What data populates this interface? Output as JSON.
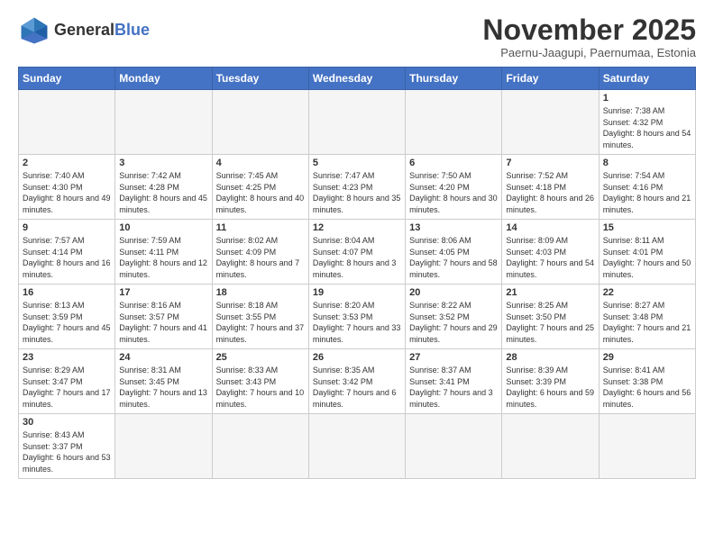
{
  "header": {
    "logo_general": "General",
    "logo_blue": "Blue",
    "month_title": "November 2025",
    "location": "Paernu-Jaagupi, Paernumaa, Estonia"
  },
  "weekdays": [
    "Sunday",
    "Monday",
    "Tuesday",
    "Wednesday",
    "Thursday",
    "Friday",
    "Saturday"
  ],
  "weeks": [
    [
      {
        "day": "",
        "info": ""
      },
      {
        "day": "",
        "info": ""
      },
      {
        "day": "",
        "info": ""
      },
      {
        "day": "",
        "info": ""
      },
      {
        "day": "",
        "info": ""
      },
      {
        "day": "",
        "info": ""
      },
      {
        "day": "1",
        "info": "Sunrise: 7:38 AM\nSunset: 4:32 PM\nDaylight: 8 hours and 54 minutes."
      }
    ],
    [
      {
        "day": "2",
        "info": "Sunrise: 7:40 AM\nSunset: 4:30 PM\nDaylight: 8 hours and 49 minutes."
      },
      {
        "day": "3",
        "info": "Sunrise: 7:42 AM\nSunset: 4:28 PM\nDaylight: 8 hours and 45 minutes."
      },
      {
        "day": "4",
        "info": "Sunrise: 7:45 AM\nSunset: 4:25 PM\nDaylight: 8 hours and 40 minutes."
      },
      {
        "day": "5",
        "info": "Sunrise: 7:47 AM\nSunset: 4:23 PM\nDaylight: 8 hours and 35 minutes."
      },
      {
        "day": "6",
        "info": "Sunrise: 7:50 AM\nSunset: 4:20 PM\nDaylight: 8 hours and 30 minutes."
      },
      {
        "day": "7",
        "info": "Sunrise: 7:52 AM\nSunset: 4:18 PM\nDaylight: 8 hours and 26 minutes."
      },
      {
        "day": "8",
        "info": "Sunrise: 7:54 AM\nSunset: 4:16 PM\nDaylight: 8 hours and 21 minutes."
      }
    ],
    [
      {
        "day": "9",
        "info": "Sunrise: 7:57 AM\nSunset: 4:14 PM\nDaylight: 8 hours and 16 minutes."
      },
      {
        "day": "10",
        "info": "Sunrise: 7:59 AM\nSunset: 4:11 PM\nDaylight: 8 hours and 12 minutes."
      },
      {
        "day": "11",
        "info": "Sunrise: 8:02 AM\nSunset: 4:09 PM\nDaylight: 8 hours and 7 minutes."
      },
      {
        "day": "12",
        "info": "Sunrise: 8:04 AM\nSunset: 4:07 PM\nDaylight: 8 hours and 3 minutes."
      },
      {
        "day": "13",
        "info": "Sunrise: 8:06 AM\nSunset: 4:05 PM\nDaylight: 7 hours and 58 minutes."
      },
      {
        "day": "14",
        "info": "Sunrise: 8:09 AM\nSunset: 4:03 PM\nDaylight: 7 hours and 54 minutes."
      },
      {
        "day": "15",
        "info": "Sunrise: 8:11 AM\nSunset: 4:01 PM\nDaylight: 7 hours and 50 minutes."
      }
    ],
    [
      {
        "day": "16",
        "info": "Sunrise: 8:13 AM\nSunset: 3:59 PM\nDaylight: 7 hours and 45 minutes."
      },
      {
        "day": "17",
        "info": "Sunrise: 8:16 AM\nSunset: 3:57 PM\nDaylight: 7 hours and 41 minutes."
      },
      {
        "day": "18",
        "info": "Sunrise: 8:18 AM\nSunset: 3:55 PM\nDaylight: 7 hours and 37 minutes."
      },
      {
        "day": "19",
        "info": "Sunrise: 8:20 AM\nSunset: 3:53 PM\nDaylight: 7 hours and 33 minutes."
      },
      {
        "day": "20",
        "info": "Sunrise: 8:22 AM\nSunset: 3:52 PM\nDaylight: 7 hours and 29 minutes."
      },
      {
        "day": "21",
        "info": "Sunrise: 8:25 AM\nSunset: 3:50 PM\nDaylight: 7 hours and 25 minutes."
      },
      {
        "day": "22",
        "info": "Sunrise: 8:27 AM\nSunset: 3:48 PM\nDaylight: 7 hours and 21 minutes."
      }
    ],
    [
      {
        "day": "23",
        "info": "Sunrise: 8:29 AM\nSunset: 3:47 PM\nDaylight: 7 hours and 17 minutes."
      },
      {
        "day": "24",
        "info": "Sunrise: 8:31 AM\nSunset: 3:45 PM\nDaylight: 7 hours and 13 minutes."
      },
      {
        "day": "25",
        "info": "Sunrise: 8:33 AM\nSunset: 3:43 PM\nDaylight: 7 hours and 10 minutes."
      },
      {
        "day": "26",
        "info": "Sunrise: 8:35 AM\nSunset: 3:42 PM\nDaylight: 7 hours and 6 minutes."
      },
      {
        "day": "27",
        "info": "Sunrise: 8:37 AM\nSunset: 3:41 PM\nDaylight: 7 hours and 3 minutes."
      },
      {
        "day": "28",
        "info": "Sunrise: 8:39 AM\nSunset: 3:39 PM\nDaylight: 6 hours and 59 minutes."
      },
      {
        "day": "29",
        "info": "Sunrise: 8:41 AM\nSunset: 3:38 PM\nDaylight: 6 hours and 56 minutes."
      }
    ],
    [
      {
        "day": "30",
        "info": "Sunrise: 8:43 AM\nSunset: 3:37 PM\nDaylight: 6 hours and 53 minutes."
      },
      {
        "day": "",
        "info": ""
      },
      {
        "day": "",
        "info": ""
      },
      {
        "day": "",
        "info": ""
      },
      {
        "day": "",
        "info": ""
      },
      {
        "day": "",
        "info": ""
      },
      {
        "day": "",
        "info": ""
      }
    ]
  ]
}
